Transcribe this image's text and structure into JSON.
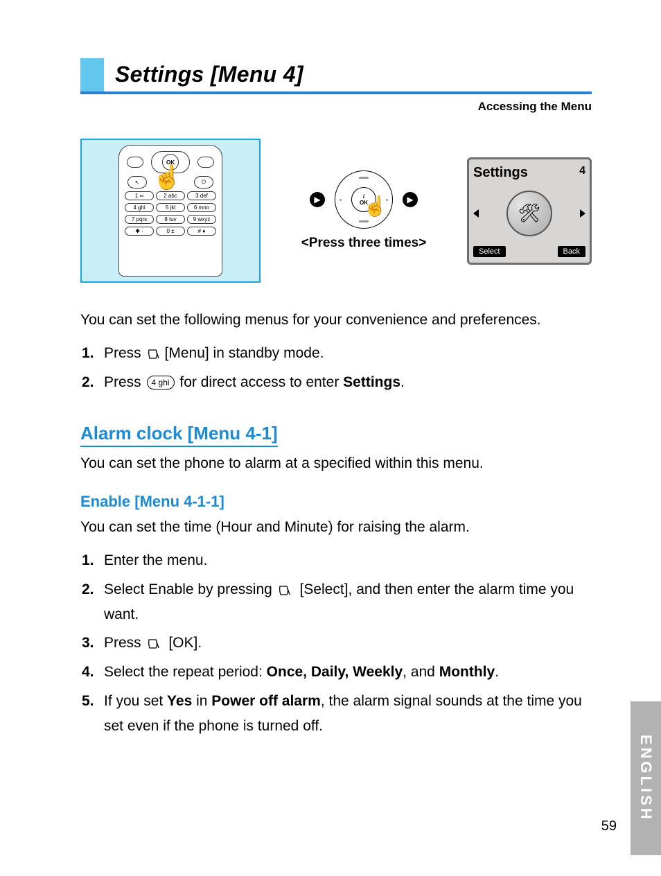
{
  "header": {
    "title": "Settings [Menu 4]",
    "subtitle": "Accessing the Menu"
  },
  "nav": {
    "caption": "<Press three times>",
    "ok": "OK"
  },
  "phone_keys": {
    "r1": [
      "1  ∞",
      "2 abc",
      "3 def"
    ],
    "r2": [
      "4 ghi",
      "5 jkl",
      "6 mno"
    ],
    "r3": [
      "7 pqrs",
      "8 tuv",
      "9 wxyz"
    ],
    "r4": [
      "✱ ·",
      "0 ±",
      "# ♦"
    ]
  },
  "screen": {
    "title": "Settings",
    "index": "4",
    "select": "Select",
    "back": "Back"
  },
  "intro": "You can set the following menus for your convenience and preferences.",
  "steps_a": {
    "s1a": "Press ",
    "s1b": "[Menu] in standby mode.",
    "s2a": "Press ",
    "s2key": "4 ghi",
    "s2b": " for direct access to enter ",
    "s2c": "Settings",
    "s2d": "."
  },
  "h2": "Alarm clock [Menu 4-1]",
  "h2_p": "You can set the phone to alarm at a specified within this menu.",
  "h3": "Enable [Menu 4-1-1]",
  "h3_p": "You can set the time (Hour and Minute) for raising the alarm.",
  "steps_b": {
    "s1": "Enter the menu.",
    "s2a": "Select Enable by pressing ",
    "s2b": " [Select], and then enter the alarm time you want.",
    "s3a": "Press ",
    "s3b": " [OK].",
    "s4a": "Select the repeat period: ",
    "s4b": "Once, Daily, Weekly",
    "s4c": ", and ",
    "s4d": "Monthly",
    "s4e": ".",
    "s5a": "If you set ",
    "s5b": "Yes",
    "s5c": " in ",
    "s5d": "Power off alarm",
    "s5e": ", the alarm signal sounds at the time you set even if the phone is turned off."
  },
  "side": "ENGLISH",
  "pagenum": "59"
}
